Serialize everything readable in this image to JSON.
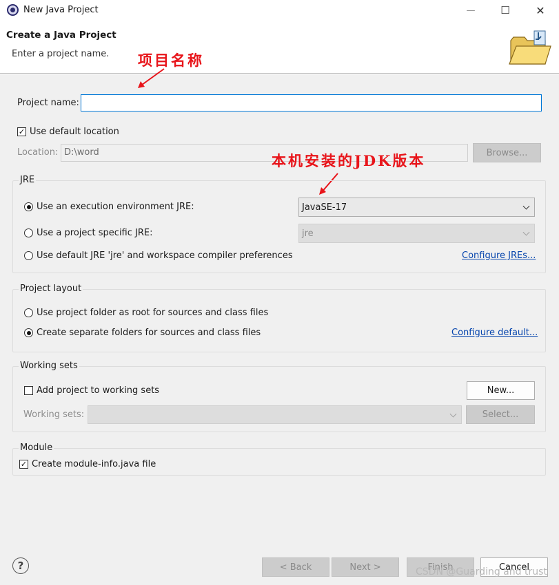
{
  "window": {
    "title": "New Java Project",
    "minimize": "—",
    "maximize": "☐",
    "close": "✕"
  },
  "banner": {
    "title": "Create a Java Project",
    "subtitle": "Enter a project name."
  },
  "annotations": {
    "project_name_note": "项目名称",
    "jdk_note": "本机安装的JDK版本"
  },
  "project": {
    "name_label": "Project name:",
    "name_value": "",
    "use_default_location_label": "Use default location",
    "use_default_location_checked": true,
    "location_label": "Location:",
    "location_value": "D:\\word",
    "browse_label": "Browse..."
  },
  "jre": {
    "group_title": "JRE",
    "option_execution_env": "Use an execution environment JRE:",
    "option_project_specific": "Use a project specific JRE:",
    "option_default": "Use default JRE 'jre' and workspace compiler preferences",
    "selected_option": "execution_env",
    "execution_env_value": "JavaSE-17",
    "project_specific_value": "jre",
    "configure_link": "Configure JREs..."
  },
  "layout": {
    "group_title": "Project layout",
    "option_root": "Use project folder as root for sources and class files",
    "option_separate": "Create separate folders for sources and class files",
    "selected_option": "separate",
    "configure_link": "Configure default..."
  },
  "working_sets": {
    "group_title": "Working sets",
    "add_label": "Add project to working sets",
    "add_checked": false,
    "new_button": "New...",
    "sets_label": "Working sets:",
    "sets_value": "",
    "select_button": "Select..."
  },
  "module": {
    "group_title": "Module",
    "create_label": "Create module-info.java file",
    "create_checked": true
  },
  "footer": {
    "help": "?",
    "back": "< Back",
    "next": "Next >",
    "finish": "Finish",
    "cancel": "Cancel",
    "watermark": "CSDN @Guarding and trust"
  },
  "colors": {
    "annotation": "#e8141a",
    "link": "#0645ad",
    "focus_border": "#0078d7"
  }
}
